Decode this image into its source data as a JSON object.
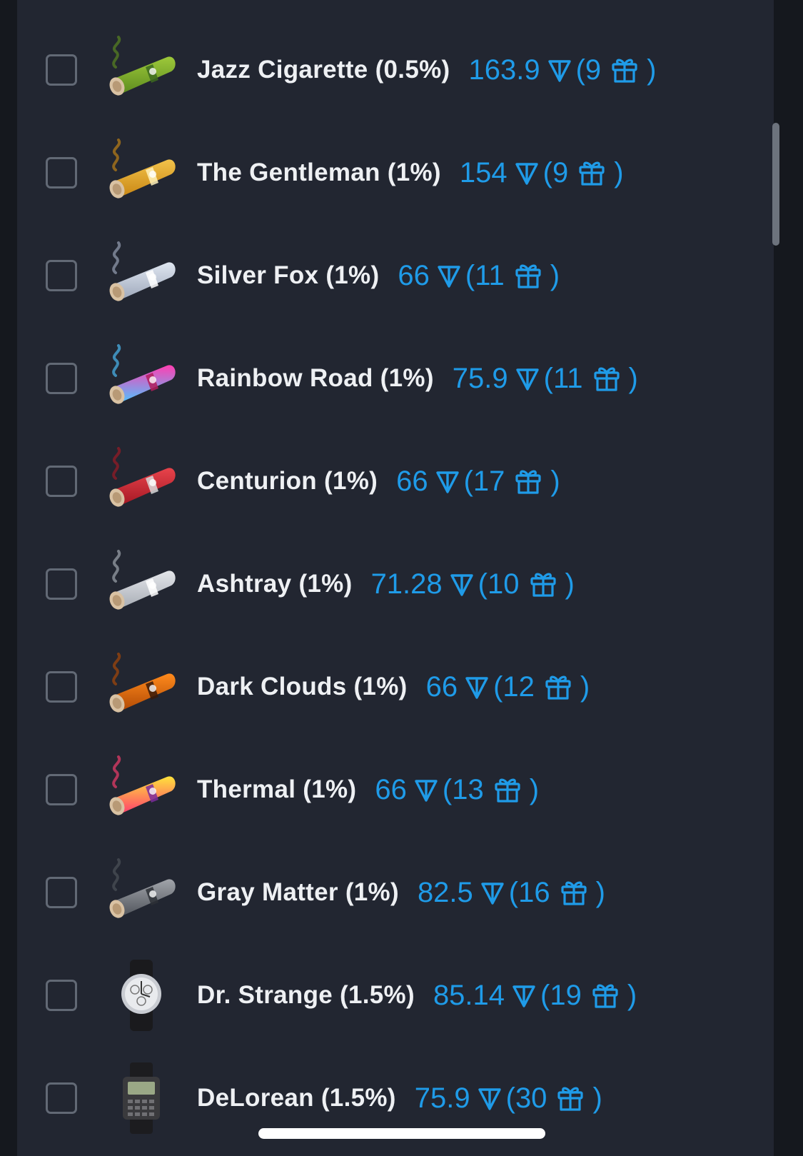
{
  "items": [
    {
      "name": "Jazz Cigarette",
      "chance": "(0.5%)",
      "price": "163.9",
      "gifts": "9",
      "icon": "cigar-green-icon",
      "kind": "cigar",
      "colors": [
        "#9dc83a",
        "#5d8c1f"
      ],
      "band": "#3c6a1e"
    },
    {
      "name": "The Gentleman",
      "chance": "(1%)",
      "price": "154",
      "gifts": "9",
      "icon": "cigar-gold-icon",
      "kind": "cigar",
      "colors": [
        "#f2c24a",
        "#c98714"
      ],
      "band": "#fff1b8"
    },
    {
      "name": "Silver Fox",
      "chance": "(1%)",
      "price": "66",
      "gifts": "11",
      "icon": "cigar-silver-icon",
      "kind": "cigar",
      "colors": [
        "#dfe6f0",
        "#9ea8bb"
      ],
      "band": "#ffffff"
    },
    {
      "name": "Rainbow Road",
      "chance": "(1%)",
      "price": "75.9",
      "gifts": "11",
      "icon": "cigar-rainbow-icon",
      "kind": "cigar",
      "colors": [
        "#ff3fb2",
        "#4fc3ff"
      ],
      "band": "#b11d5c"
    },
    {
      "name": "Centurion",
      "chance": "(1%)",
      "price": "66",
      "gifts": "17",
      "icon": "cigar-red-icon",
      "kind": "cigar",
      "colors": [
        "#e8434b",
        "#a51824"
      ],
      "band": "#d9d9d9"
    },
    {
      "name": "Ashtray",
      "chance": "(1%)",
      "price": "71.28",
      "gifts": "10",
      "icon": "cigar-gray-icon",
      "kind": "cigar",
      "colors": [
        "#e4e6ea",
        "#a8adb5"
      ],
      "band": "#ffffff"
    },
    {
      "name": "Dark Clouds",
      "chance": "(1%)",
      "price": "66",
      "gifts": "12",
      "icon": "cigar-orange-icon",
      "kind": "cigar",
      "colors": [
        "#ff8a1c",
        "#b14a05"
      ],
      "band": "#3a1a08"
    },
    {
      "name": "Thermal",
      "chance": "(1%)",
      "price": "66",
      "gifts": "13",
      "icon": "cigar-thermal-icon",
      "kind": "cigar",
      "colors": [
        "#ffe23b",
        "#ff3d6e"
      ],
      "band": "#7a2c9b"
    },
    {
      "name": "Gray Matter",
      "chance": "(1%)",
      "price": "82.5",
      "gifts": "16",
      "icon": "cigar-dark-gray-icon",
      "kind": "cigar",
      "colors": [
        "#a1a4aa",
        "#50545b"
      ],
      "band": "#2d3036"
    },
    {
      "name": "Dr. Strange",
      "chance": "(1.5%)",
      "price": "85.14",
      "gifts": "19",
      "icon": "watch-analog-icon",
      "kind": "watch",
      "colors": [
        "#e9ebee",
        "#1f1f22"
      ],
      "band": "#1a1a1d"
    },
    {
      "name": "DeLorean",
      "chance": "(1.5%)",
      "price": "75.9",
      "gifts": "30",
      "icon": "watch-digital-icon",
      "kind": "digital",
      "colors": [
        "#3a3a3d",
        "#1c1c1f"
      ],
      "band": "#9aa886"
    }
  ],
  "currency_icon": "ton-icon",
  "gift_icon": "gift-icon",
  "price_color": "#1f9be8"
}
